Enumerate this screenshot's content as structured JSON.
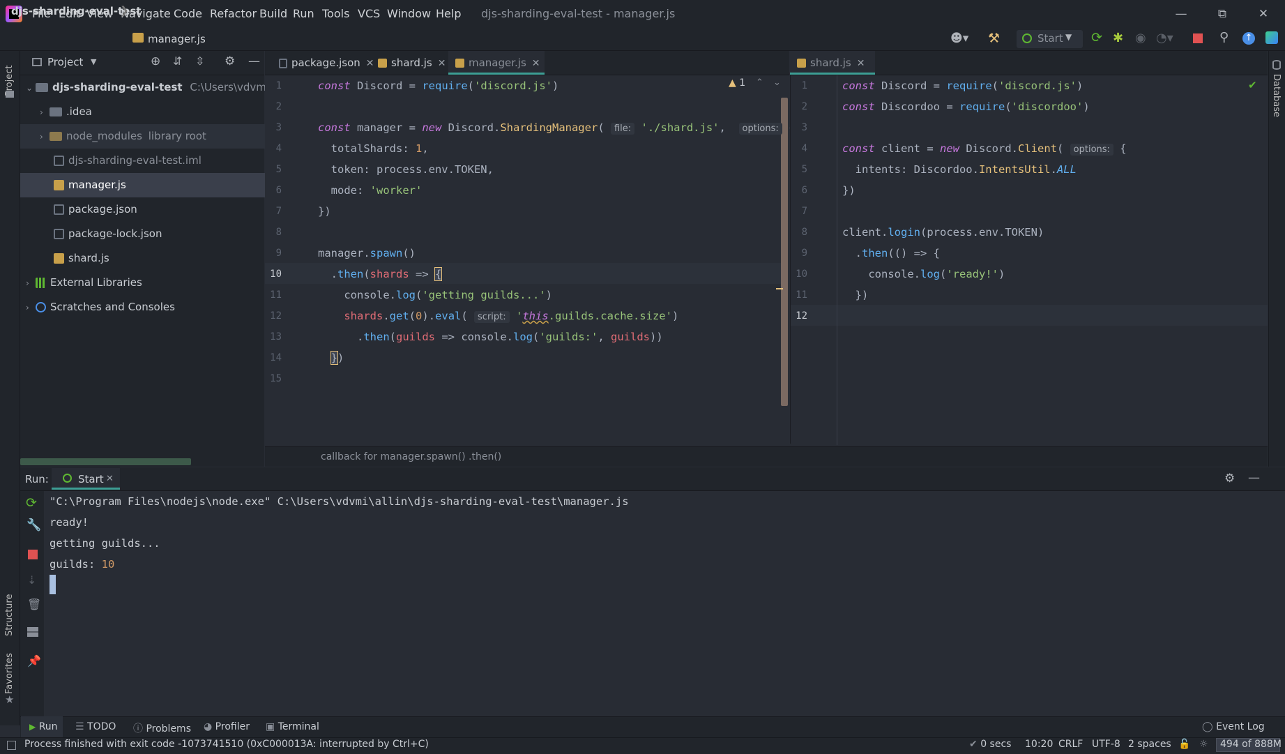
{
  "window": {
    "title": "djs-sharding-eval-test - manager.js",
    "menu": [
      "File",
      "Edit",
      "View",
      "Navigate",
      "Code",
      "Refactor",
      "Build",
      "Run",
      "Tools",
      "VCS",
      "Window",
      "Help"
    ]
  },
  "navbar": {
    "project": "djs-sharding-eval-test",
    "file": "manager.js",
    "run_config": "Start"
  },
  "left_strip": {
    "project_label": "Project",
    "structure_label": "Structure",
    "favorites_label": "Favorites"
  },
  "right_strip": {
    "database_label": "Database"
  },
  "project_panel": {
    "title": "Project",
    "root_name": "djs-sharding-eval-test",
    "root_path": "C:\\Users\\vdvmi\\allin\\",
    "items": [
      {
        "label": ".idea"
      },
      {
        "label": "node_modules",
        "suffix": "library root"
      },
      {
        "label": "djs-sharding-eval-test.iml"
      },
      {
        "label": "manager.js"
      },
      {
        "label": "package.json"
      },
      {
        "label": "package-lock.json"
      },
      {
        "label": "shard.js"
      },
      {
        "label": "External Libraries"
      },
      {
        "label": "Scratches and Consoles"
      }
    ]
  },
  "editor_left": {
    "tabs": [
      "package.json",
      "shard.js",
      "manager.js"
    ],
    "active_tab": "manager.js",
    "warning_count": "1",
    "line_numbers": [
      "1",
      "2",
      "3",
      "4",
      "5",
      "6",
      "7",
      "8",
      "9",
      "10",
      "11",
      "12",
      "13",
      "14",
      "15"
    ],
    "lines": [
      "const Discord = require('discord.js')",
      "",
      "const manager = new Discord.ShardingManager( file: './shard.js',  options: {",
      "  totalShards: 1,",
      "  token: process.env.TOKEN,",
      "  mode: 'worker'",
      "})",
      "",
      "manager.spawn()",
      "  .then(shards => {",
      "    console.log('getting guilds...')",
      "    shards.get(0).eval( script: 'this.guilds.cache.size')",
      "      .then(guilds => console.log('guilds:', guilds))",
      "  })",
      ""
    ],
    "breadcrumb": "callback for manager.spawn() .then()"
  },
  "editor_right": {
    "tabs": [
      "shard.js"
    ],
    "line_numbers": [
      "1",
      "2",
      "3",
      "4",
      "5",
      "6",
      "7",
      "8",
      "9",
      "10",
      "11",
      "12"
    ],
    "lines": [
      "const Discord = require('discord.js')",
      "const Discordoo = require('discordoo')",
      "",
      "const client = new Discord.Client( options: {",
      "  intents: Discordoo.IntentsUtil.ALL",
      "})",
      "",
      "client.login(process.env.TOKEN)",
      "  .then(() => {",
      "    console.log('ready!')",
      "  })",
      ""
    ]
  },
  "run_panel": {
    "label": "Run:",
    "tab": "Start",
    "console": [
      "\"C:\\Program Files\\nodejs\\node.exe\" C:\\Users\\vdvmi\\allin\\djs-sharding-eval-test\\manager.js",
      "ready!",
      "getting guilds...",
      "guilds: 10"
    ],
    "guilds_label": "guilds: ",
    "guilds_value": "10"
  },
  "bottom_tools": [
    "Run",
    "TODO",
    "Problems",
    "Profiler",
    "Terminal"
  ],
  "event_log": "Event Log",
  "status": {
    "message": "Process finished with exit code -1073741510 (0xC000013A: interrupted by Ctrl+C)",
    "time": "0 secs",
    "position": "10:20",
    "line_sep": "CRLF",
    "encoding": "UTF-8",
    "indent": "2 spaces",
    "memory": "494 of 888M"
  },
  "colors": {
    "accent": "#3d9e94",
    "stop_red": "#e05252",
    "run_green": "#5fb832",
    "string_green": "#98c379",
    "keyword_purple": "#c678dd",
    "number_orange": "#d19a66"
  }
}
